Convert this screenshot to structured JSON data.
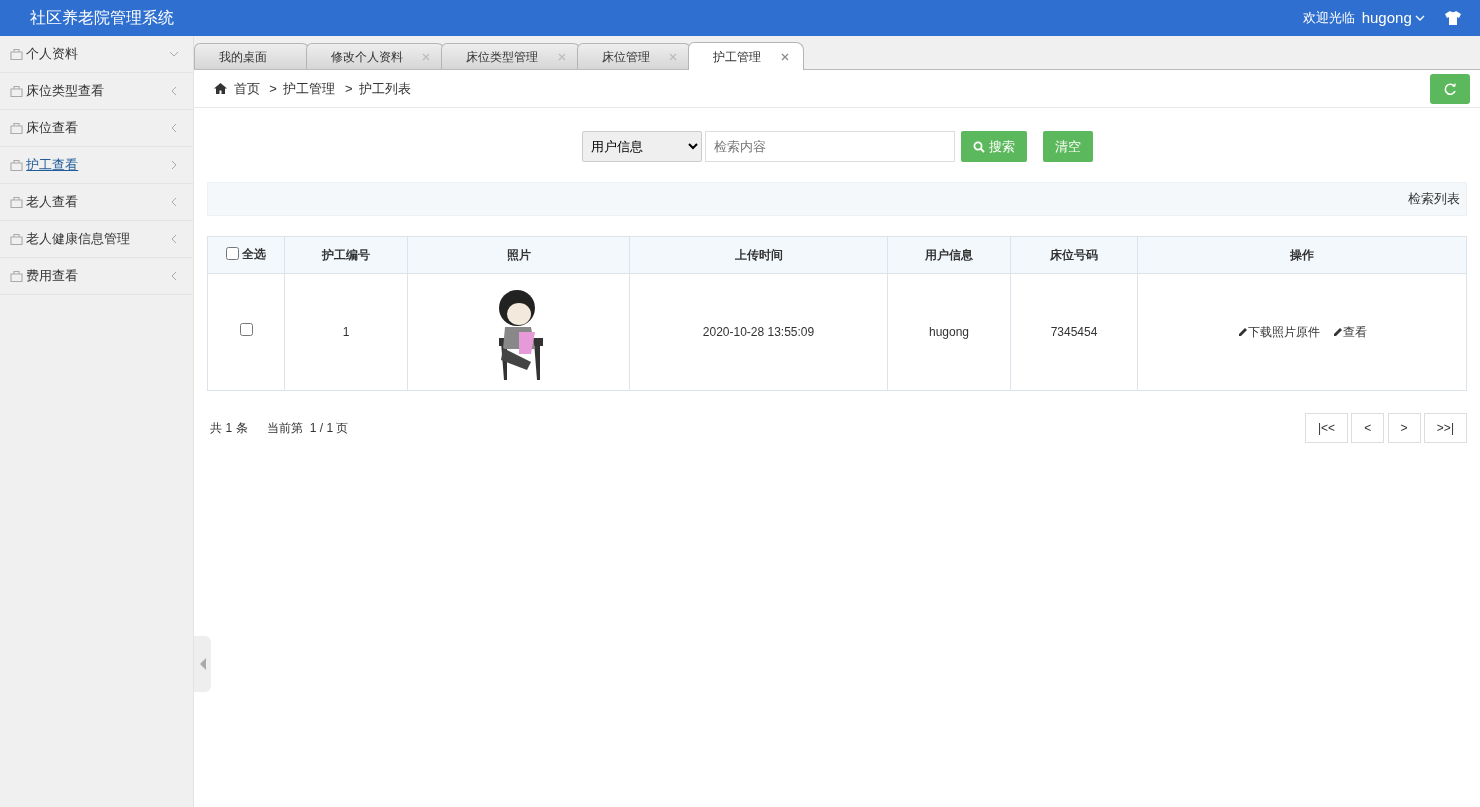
{
  "header": {
    "title": "社区养老院管理系统",
    "welcome": "欢迎光临",
    "user": "hugong"
  },
  "sidebar": {
    "items": [
      {
        "label": "个人资料",
        "expanded": true,
        "selected": false
      },
      {
        "label": "床位类型查看",
        "expanded": false,
        "selected": false
      },
      {
        "label": "床位查看",
        "expanded": false,
        "selected": false
      },
      {
        "label": "护工查看",
        "expanded": false,
        "selected": true
      },
      {
        "label": "老人查看",
        "expanded": false,
        "selected": false
      },
      {
        "label": "老人健康信息管理",
        "expanded": false,
        "selected": false
      },
      {
        "label": "费用查看",
        "expanded": false,
        "selected": false
      }
    ]
  },
  "tabs": [
    {
      "label": "我的桌面",
      "selected": false,
      "closable": false
    },
    {
      "label": "修改个人资料",
      "selected": false,
      "closable": true
    },
    {
      "label": "床位类型管理",
      "selected": false,
      "closable": true
    },
    {
      "label": "床位管理",
      "selected": false,
      "closable": true
    },
    {
      "label": "护工管理",
      "selected": true,
      "closable": true
    }
  ],
  "breadcrumb": {
    "items": [
      "首页",
      "护工管理",
      "护工列表"
    ],
    "separator": ">"
  },
  "search": {
    "field": "用户信息",
    "placeholder": "检索内容",
    "search_button": "搜索",
    "clear_button": "清空"
  },
  "list_title": "检索列表",
  "table": {
    "select_all": {
      "label": "全选",
      "checked": false
    },
    "columns": [
      "护工编号",
      "照片",
      "上传时间",
      "用户信息",
      "床位号码",
      "操作"
    ],
    "rows": [
      {
        "checked": false,
        "id": "1",
        "photo": {
          "kind": "picture"
        },
        "uploaded": "2020-10-28 13:55:09",
        "user": "hugong",
        "bed": "7345454",
        "actions": [
          "下载照片原件",
          "查看"
        ]
      }
    ]
  },
  "pagination": {
    "total": "共 1 条",
    "current": "当前第  1 / 1 页",
    "buttons": [
      "|<<",
      "<",
      ">",
      ">>|"
    ]
  }
}
